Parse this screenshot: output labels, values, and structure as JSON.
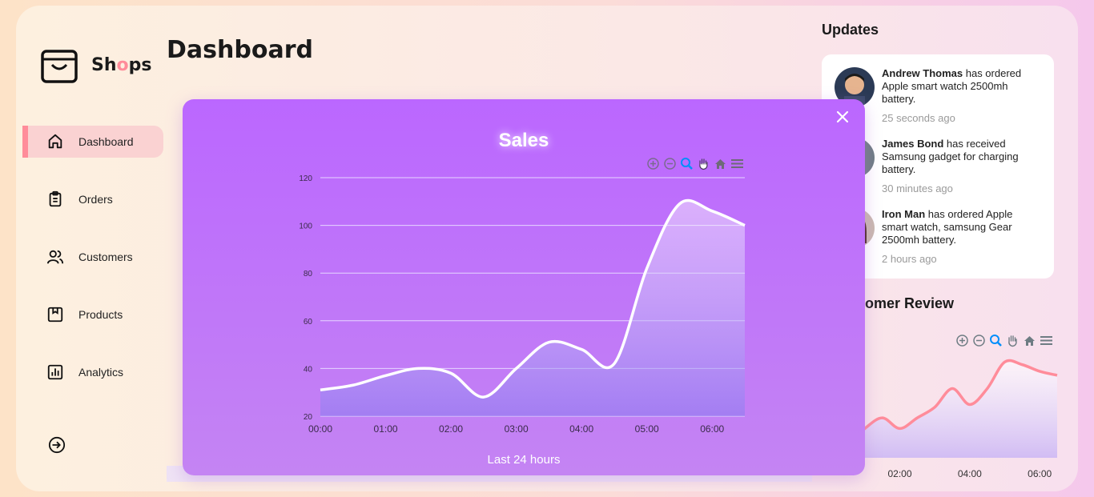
{
  "brand": {
    "prefix": "Sh",
    "o": "o",
    "suffix": "ps"
  },
  "page": {
    "title": "Dashboard"
  },
  "sidebar": {
    "items": [
      {
        "label": "Dashboard",
        "icon": "home-icon",
        "active": true
      },
      {
        "label": "Orders",
        "icon": "clipboard-icon"
      },
      {
        "label": "Customers",
        "icon": "users-icon"
      },
      {
        "label": "Products",
        "icon": "box-icon"
      },
      {
        "label": "Analytics",
        "icon": "bar-chart-icon"
      }
    ],
    "logout_icon": "logout-icon"
  },
  "updates": {
    "title": "Updates",
    "items": [
      {
        "name": "Andrew Thomas",
        "text": " has ordered Apple smart watch 2500mh battery.",
        "time": "25 seconds ago"
      },
      {
        "name": "James Bond",
        "text": " has received Samsung gadget for charging battery.",
        "time": "30 minutes ago"
      },
      {
        "name": "Iron Man",
        "text": " has ordered Apple smart watch, samsung Gear 2500mh battery.",
        "time": "2 hours ago"
      }
    ]
  },
  "review": {
    "title": "Customer Review"
  },
  "modal": {
    "title": "Sales",
    "subtitle": "Last 24 hours"
  },
  "colors": {
    "modal_bg": "#bb67ff",
    "accent": "#ff8c9a",
    "line": "#ffffff",
    "review_line": "#ff8c9a"
  },
  "chart_data": [
    {
      "type": "area",
      "title": "Sales",
      "x": [
        "00:00",
        "00:30",
        "01:00",
        "01:30",
        "02:00",
        "02:30",
        "03:00",
        "03:30",
        "04:00",
        "04:30",
        "05:00",
        "05:30",
        "06:00",
        "06:30"
      ],
      "x_tick_labels": [
        "00:00",
        "01:00",
        "02:00",
        "03:00",
        "04:00",
        "05:00",
        "06:00"
      ],
      "series": [
        {
          "values": [
            31,
            33,
            37,
            40,
            38,
            28,
            40,
            51,
            48,
            42,
            82,
            109,
            106,
            100
          ]
        }
      ],
      "ylim": [
        20,
        120
      ],
      "y_ticks": [
        20,
        40,
        60,
        80,
        100,
        120
      ],
      "grid": true
    },
    {
      "type": "area",
      "title": "Customer Review",
      "x": [
        "00:30",
        "01:00",
        "01:30",
        "02:00",
        "02:30",
        "03:00",
        "03:30",
        "04:00",
        "04:30",
        "05:00",
        "05:30",
        "06:00",
        "06:30"
      ],
      "x_tick_labels": [
        "02:00",
        "04:00",
        "06:00"
      ],
      "series": [
        {
          "values": [
            10,
            22,
            30,
            22,
            30,
            38,
            52,
            40,
            52,
            72,
            70,
            65,
            62
          ]
        }
      ],
      "grid": false
    }
  ]
}
